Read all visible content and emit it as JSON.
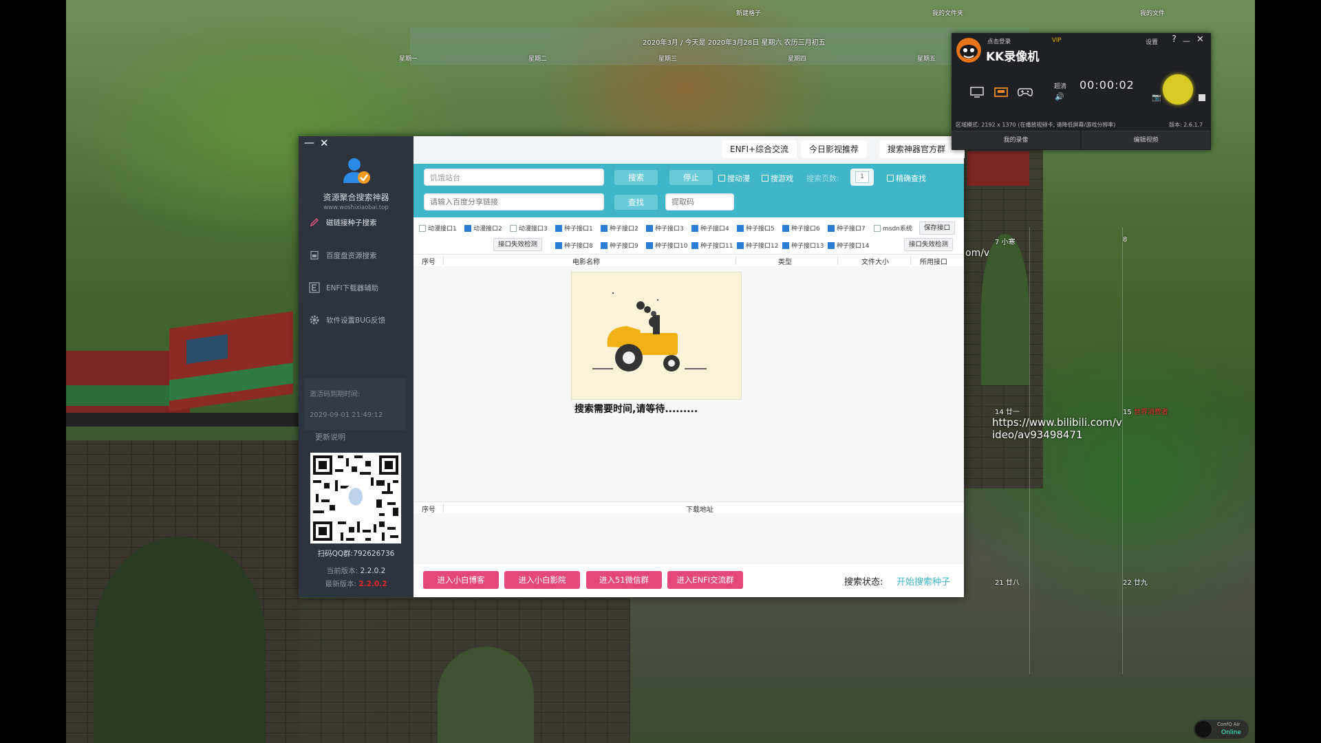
{
  "desktop": {
    "top_labels": [
      "新建格子",
      "我的文件夹",
      "我的文件"
    ],
    "calendar_date": "2020年3月 / 今天是 2020年3月28日 星期六 农历三月初五",
    "weekdays": [
      "星期一",
      "星期二",
      "星期三",
      "星期四",
      "星期五"
    ],
    "cal_day_7": "7 小寒",
    "cal_day_8": "8",
    "cal_day_14": "14 廿一",
    "cal_day_15": "15",
    "cal_day_15_note": "世界消费者",
    "cal_day_21": "21 廿八",
    "cal_day_22": "22 廿九",
    "bili_partial": "om/v",
    "bili_link_line1": "https://www.bilibili.com/v",
    "bili_link_line2": "ideo/av93498471",
    "online_label_1": "ConfQ Air",
    "online_label_2": "Online"
  },
  "app": {
    "minimize": "—",
    "close": "✕",
    "logo_title": "资源聚合搜索神器",
    "logo_url": "www.woshixiaobai.top",
    "nav": [
      {
        "label": "磁链接种子搜索",
        "icon": "pencil-icon"
      },
      {
        "label": "百度盘资源搜索",
        "icon": "document-icon"
      },
      {
        "label": "ENFI下载器辅助",
        "icon": "e-icon"
      },
      {
        "label": "软件设置BUG反馈",
        "icon": "gear-icon"
      }
    ],
    "expiry_label": "激活码到期时间:",
    "expiry_value": "2029-09-01 21:49:12",
    "update_note": "更新说明",
    "qq_group": "扫码QQ群:792626736",
    "current_version_label": "当前版本:",
    "current_version": "2.2.0.2",
    "latest_version_label": "最新版本:",
    "latest_version": "2.2.0.2",
    "tabs": [
      "ENFI+综合交流",
      "今日影视推荐",
      "搜索神器官方群"
    ],
    "search_value": "饥饿站台",
    "search_btn": "搜索",
    "stop_btn": "停止",
    "opt_anime": "搜动漫",
    "opt_game": "搜游戏",
    "pages_label": "搜索页数:",
    "pages_value": "1",
    "exact_search": "精确查找",
    "baidu_placeholder": "请输入百度分享链接",
    "find_btn": "查找",
    "code_placeholder": "提取码",
    "ifaces_row1": [
      {
        "label": "动漫接口1",
        "checked": false
      },
      {
        "label": "动漫接口2",
        "checked": true
      },
      {
        "label": "动漫接口3",
        "checked": false
      },
      {
        "label": "种子接口1",
        "checked": true
      },
      {
        "label": "种子接口2",
        "checked": true
      },
      {
        "label": "种子接口3",
        "checked": true
      },
      {
        "label": "种子接口4",
        "checked": true
      },
      {
        "label": "种子接口5",
        "checked": true
      },
      {
        "label": "种子接口6",
        "checked": true
      },
      {
        "label": "种子接口7",
        "checked": true
      },
      {
        "label": "msdn系统",
        "checked": false
      }
    ],
    "ifaces_row2": [
      {
        "label": "种子接口8",
        "checked": true
      },
      {
        "label": "种子接口9",
        "checked": true
      },
      {
        "label": "种子接口10",
        "checked": true
      },
      {
        "label": "种子接口11",
        "checked": true
      },
      {
        "label": "种子接口12",
        "checked": true
      },
      {
        "label": "种子接口13",
        "checked": true
      },
      {
        "label": "种子接口14",
        "checked": true
      }
    ],
    "save_iface_btn": "保存接口",
    "iface_check_btn_left": "接口失效检测",
    "iface_check_btn_right": "接口失效检测",
    "results_headers": [
      "序号",
      "电影名称",
      "类型",
      "文件大小",
      "所用接口"
    ],
    "loading_text": "搜索需要时间,请等待.........",
    "dl_headers": [
      "序号",
      "下载地址"
    ],
    "bottom_buttons": [
      "进入小白博客",
      "进入小白影院",
      "进入51微信群",
      "进入ENFI交流群"
    ],
    "status_label": "搜索状态:",
    "status_value": "开始搜索种子"
  },
  "kk": {
    "login": "点击登录",
    "vip": "VIP",
    "title": "KK录像机",
    "settings": "设置",
    "help": "?",
    "minimize": "—",
    "close": "✕",
    "quality": "超清",
    "timer": "00:00:02",
    "info": "区域模式: 2192 x 1370 (在播放视频卡, 请降低屏幕/游戏分辨率)",
    "version": "版本: 2.6.1.7",
    "tab_my": "我的录像",
    "tab_edit": "编辑视频"
  },
  "colors": {
    "sidebar": "#2e343d",
    "teal": "#3fb7c9",
    "pink": "#e4477a",
    "version_red": "#e3242b",
    "kk_record": "#d8cb23"
  }
}
